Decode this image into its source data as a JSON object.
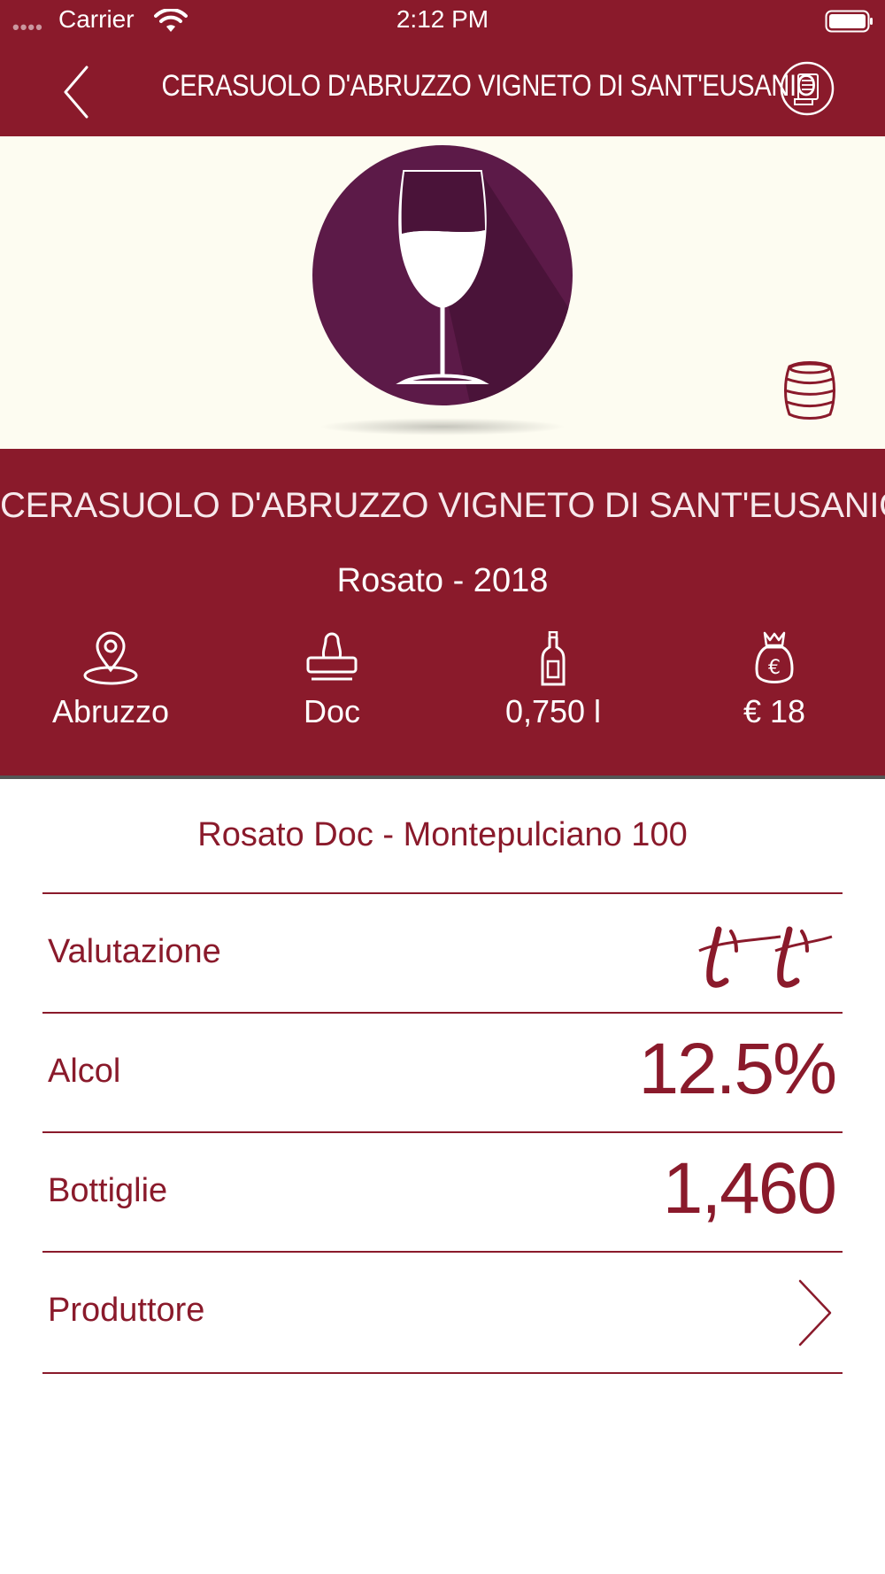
{
  "status_bar": {
    "signal": "••••",
    "carrier": "Carrier",
    "time": "2:12 PM"
  },
  "nav": {
    "title": "CERASUOLO D'ABRUZZO VIGNETO DI SANT'EUSANIO"
  },
  "wine": {
    "name": "CERASUOLO D'ABRUZZO VIGNETO DI SANT'EUSANIO",
    "type_year": "Rosato - 2018",
    "stats": [
      {
        "icon": "location-pin-icon",
        "label": "Abruzzo"
      },
      {
        "icon": "stamp-icon",
        "label": "Doc"
      },
      {
        "icon": "bottle-icon",
        "label": "0,750 l"
      },
      {
        "icon": "money-bag-icon",
        "label": "€ 18"
      }
    ]
  },
  "details": {
    "subtitle": "Rosato Doc - Montepulciano 100",
    "rows": [
      {
        "key": "Valutazione",
        "value": "",
        "icon": "rating-icon"
      },
      {
        "key": "Alcol",
        "value": "12.5%"
      },
      {
        "key": "Bottiglie",
        "value": "1,460"
      },
      {
        "key": "Produttore",
        "value": "",
        "icon": "chevron-right-icon"
      }
    ]
  },
  "colors": {
    "accent": "#8a1a2b",
    "hero_background": "#fdfcf1",
    "glass_circle": "#5c1a48"
  }
}
